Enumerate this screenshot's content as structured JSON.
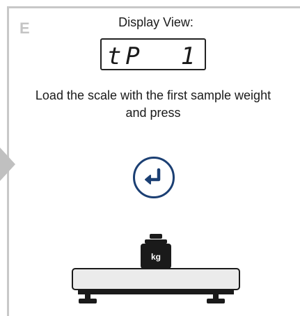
{
  "step": {
    "letter": "E"
  },
  "display": {
    "label": "Display View:",
    "readout": "tP  1"
  },
  "instruction": {
    "line1": "Load the scale with the first sample weight",
    "line2": "and press"
  },
  "weight": {
    "unit_label": "kg"
  },
  "icons": {
    "enter": "enter-key-icon",
    "nav_arrow": "triangle-right-icon"
  },
  "colors": {
    "accent": "#1b3f73",
    "muted": "#c4c4c4",
    "scale_platform": "#ebebeb",
    "dark": "#1a1a1a"
  }
}
